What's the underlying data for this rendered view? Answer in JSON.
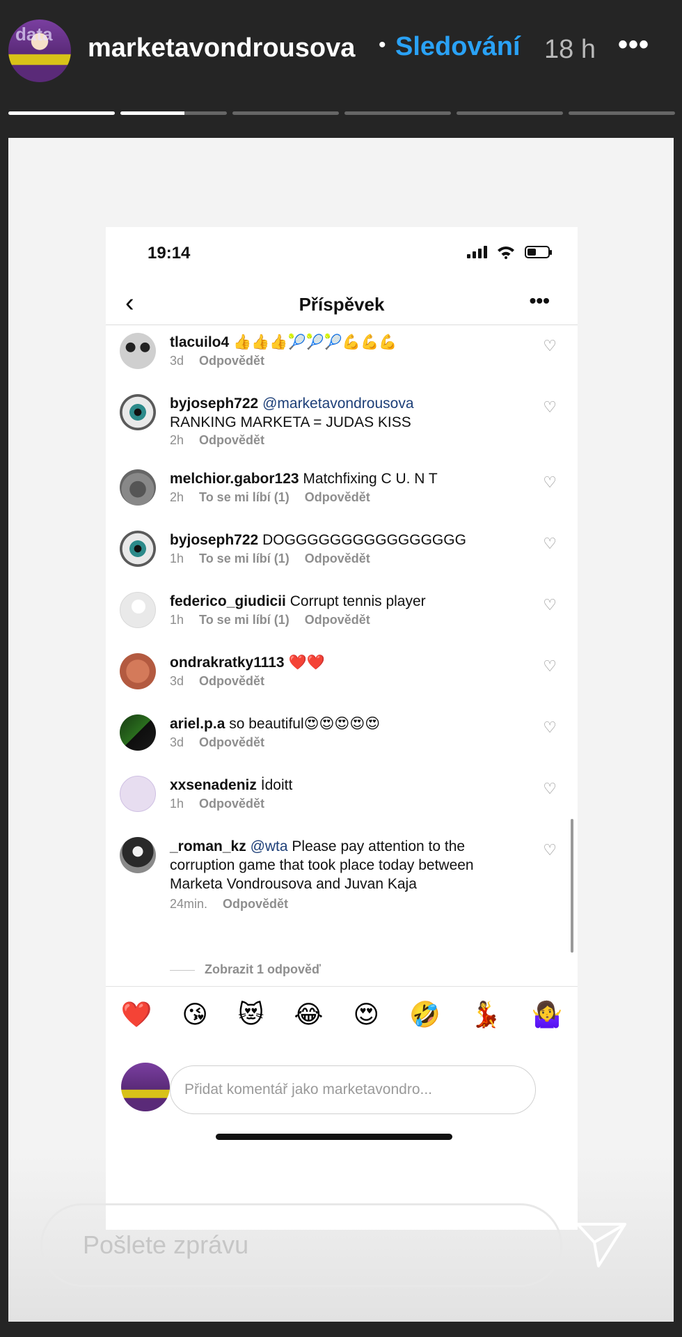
{
  "story": {
    "username": "marketavondrousova",
    "follow_label": "Sledování",
    "time": "18 h",
    "more_label": "•••",
    "avatar_text": "data",
    "progress_segments": [
      1.0,
      0.6,
      0,
      0,
      0,
      0
    ],
    "reply_placeholder": "Pošlete zprávu"
  },
  "phone": {
    "status_time": "19:14",
    "nav_title": "Příspěvek",
    "nav_more": "•••",
    "view_replies": "Zobrazit 1 odpověď",
    "comment_placeholder": "Přidat komentář jako marketavondro...",
    "reactions": [
      "❤️",
      "😘",
      "😻",
      "😂",
      "😍",
      "🤣",
      "💃",
      "🤷‍♀️"
    ],
    "comments": [
      {
        "user": "tlacuilo4",
        "mention": "",
        "text": "👍👍👍🎾🎾🎾💪💪💪",
        "time": "3d",
        "likes": "",
        "reply": "Odpovědět"
      },
      {
        "user": "byjoseph722",
        "mention": "@marketavondrousova",
        "text": "RANKING MARKETA =  JUDAS KISS",
        "time": "2h",
        "likes": "",
        "reply": "Odpovědět"
      },
      {
        "user": "melchior.gabor123",
        "mention": "",
        "text": "Matchfixing C U. N T",
        "time": "2h",
        "likes": "To se mi líbí (1)",
        "reply": "Odpovědět"
      },
      {
        "user": "byjoseph722",
        "mention": "",
        "text": "DOGGGGGGGGGGGGGGGG",
        "time": "1h",
        "likes": "To se mi líbí (1)",
        "reply": "Odpovědět"
      },
      {
        "user": "federico_giudicii",
        "mention": "",
        "text": "Corrupt tennis player",
        "time": "1h",
        "likes": "To se mi líbí (1)",
        "reply": "Odpovědět"
      },
      {
        "user": "ondrakratky1113",
        "mention": "",
        "text": "❤️❤️",
        "time": "3d",
        "likes": "",
        "reply": "Odpovědět"
      },
      {
        "user": "ariel.p.a",
        "mention": "",
        "text": "so beautiful😍😍😍😍😍",
        "time": "3d",
        "likes": "",
        "reply": "Odpovědět"
      },
      {
        "user": "xxsenadeniz",
        "mention": "",
        "text": "İdoitt",
        "time": "1h",
        "likes": "",
        "reply": "Odpovědět"
      },
      {
        "user": "_roman_kz",
        "mention": "@wta",
        "text": "Please pay attention to the corruption game that took place today between Marketa Vondrousova and Juvan Kaja",
        "time": "24min.",
        "likes": "",
        "reply": "Odpovědět"
      }
    ]
  }
}
